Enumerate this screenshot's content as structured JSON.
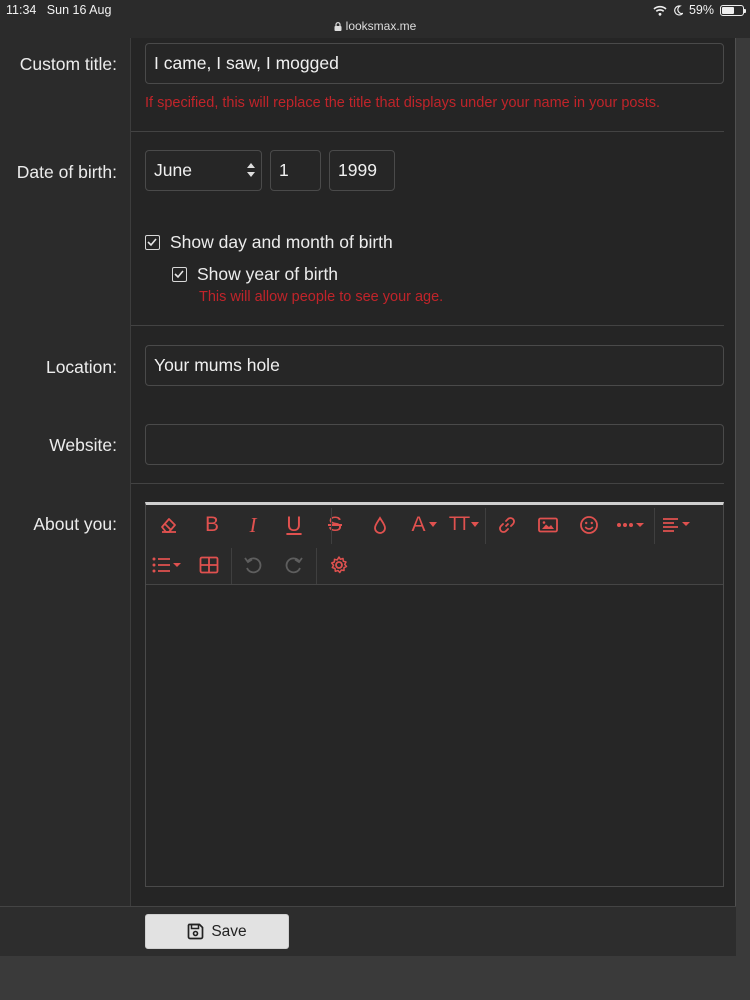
{
  "statusbar": {
    "time": "11:34",
    "date": "Sun 16 Aug",
    "url": "looksmax.me",
    "battery": "59%",
    "battery_level": 0.59
  },
  "form": {
    "custom_title": {
      "label": "Custom title:",
      "value": "I came, I saw, I mogged",
      "hint": "If specified, this will replace the title that displays under your name in your posts."
    },
    "dob": {
      "label": "Date of birth:",
      "month": "June",
      "day": "1",
      "year": "1999",
      "show_day_month": "Show day and month of birth",
      "show_year": "Show year of birth",
      "age_hint": "This will allow people to see your age."
    },
    "location": {
      "label": "Location:",
      "value": "Your mums hole"
    },
    "website": {
      "label": "Website:",
      "value": ""
    },
    "about": {
      "label": "About you:",
      "value": ""
    }
  },
  "toolbar": {
    "icons": [
      "eraser-icon",
      "bold-icon",
      "italic-icon",
      "underline-icon",
      "strikethrough-icon",
      "text-color-icon",
      "font-family-icon",
      "font-size-icon",
      "link-icon",
      "image-icon",
      "emoji-icon",
      "more-options-icon",
      "align-icon",
      "list-icon",
      "table-icon",
      "undo-icon",
      "redo-icon",
      "settings-icon"
    ],
    "bold": "B",
    "italic": "I",
    "underline": "U",
    "strike": "S",
    "font": "A",
    "size": "TT"
  },
  "footer": {
    "save_label": "Save"
  },
  "colors": {
    "accent": "#e0514f",
    "hint": "#c0242a",
    "panel": "#252525"
  }
}
